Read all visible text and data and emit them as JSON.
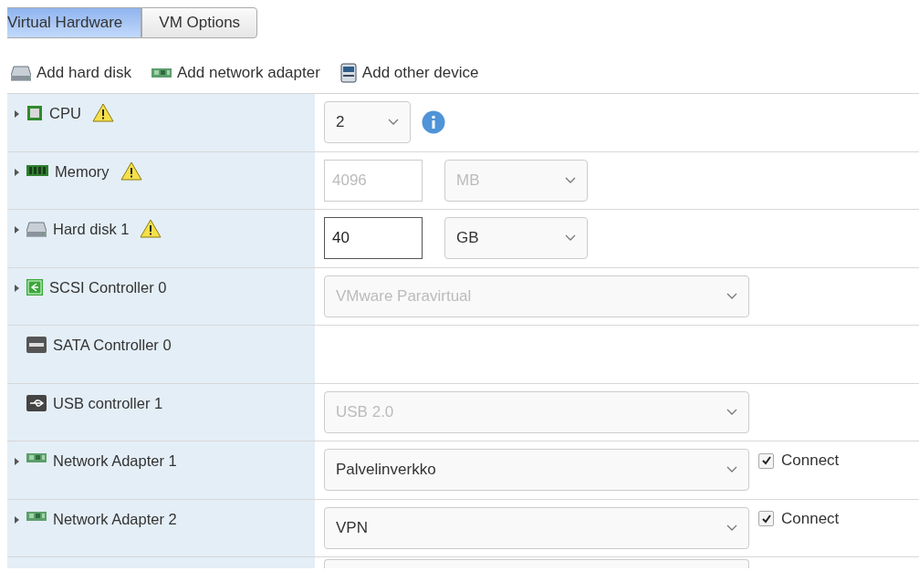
{
  "tabs": [
    {
      "label": "Virtual Hardware",
      "selected": true
    },
    {
      "label": "VM Options",
      "selected": false
    }
  ],
  "toolbar": [
    {
      "kind": "disk",
      "label": "Add hard disk"
    },
    {
      "kind": "nic",
      "label": "Add network adapter"
    },
    {
      "kind": "device",
      "label": "Add other device"
    }
  ],
  "devices": [
    {
      "kind": "cpu",
      "label": "CPU",
      "expandable": true,
      "warning": true,
      "select": {
        "value": "2",
        "disabled": false
      },
      "info": true
    },
    {
      "kind": "memory",
      "label": "Memory",
      "expandable": true,
      "warning": true,
      "input": {
        "value": "4096",
        "disabled": true
      },
      "unit": {
        "value": "MB",
        "disabled": true
      }
    },
    {
      "kind": "disk",
      "label": "Hard disk 1",
      "expandable": true,
      "warning": true,
      "input": {
        "value": "40",
        "disabled": false
      },
      "unit": {
        "value": "GB",
        "disabled": false
      }
    },
    {
      "kind": "scsi",
      "label": "SCSI Controller 0",
      "expandable": true,
      "warning": false,
      "select": {
        "value": "VMware Paravirtual",
        "disabled": true
      }
    },
    {
      "kind": "sata",
      "label": "SATA Controller 0",
      "expandable": false,
      "warning": false
    },
    {
      "kind": "usb",
      "label": "USB controller 1",
      "expandable": false,
      "warning": false,
      "select": {
        "value": "USB 2.0",
        "disabled": true
      }
    },
    {
      "kind": "nic",
      "label": "Network Adapter 1",
      "expandable": true,
      "warning": false,
      "select": {
        "value": "Palvelinverkko",
        "disabled": false
      },
      "connect": {
        "label": "Connect",
        "checked": true
      }
    },
    {
      "kind": "nic",
      "label": "Network Adapter 2",
      "expandable": true,
      "warning": false,
      "select": {
        "value": "VPN",
        "disabled": false
      },
      "connect": {
        "label": "Connect",
        "checked": true
      }
    }
  ]
}
